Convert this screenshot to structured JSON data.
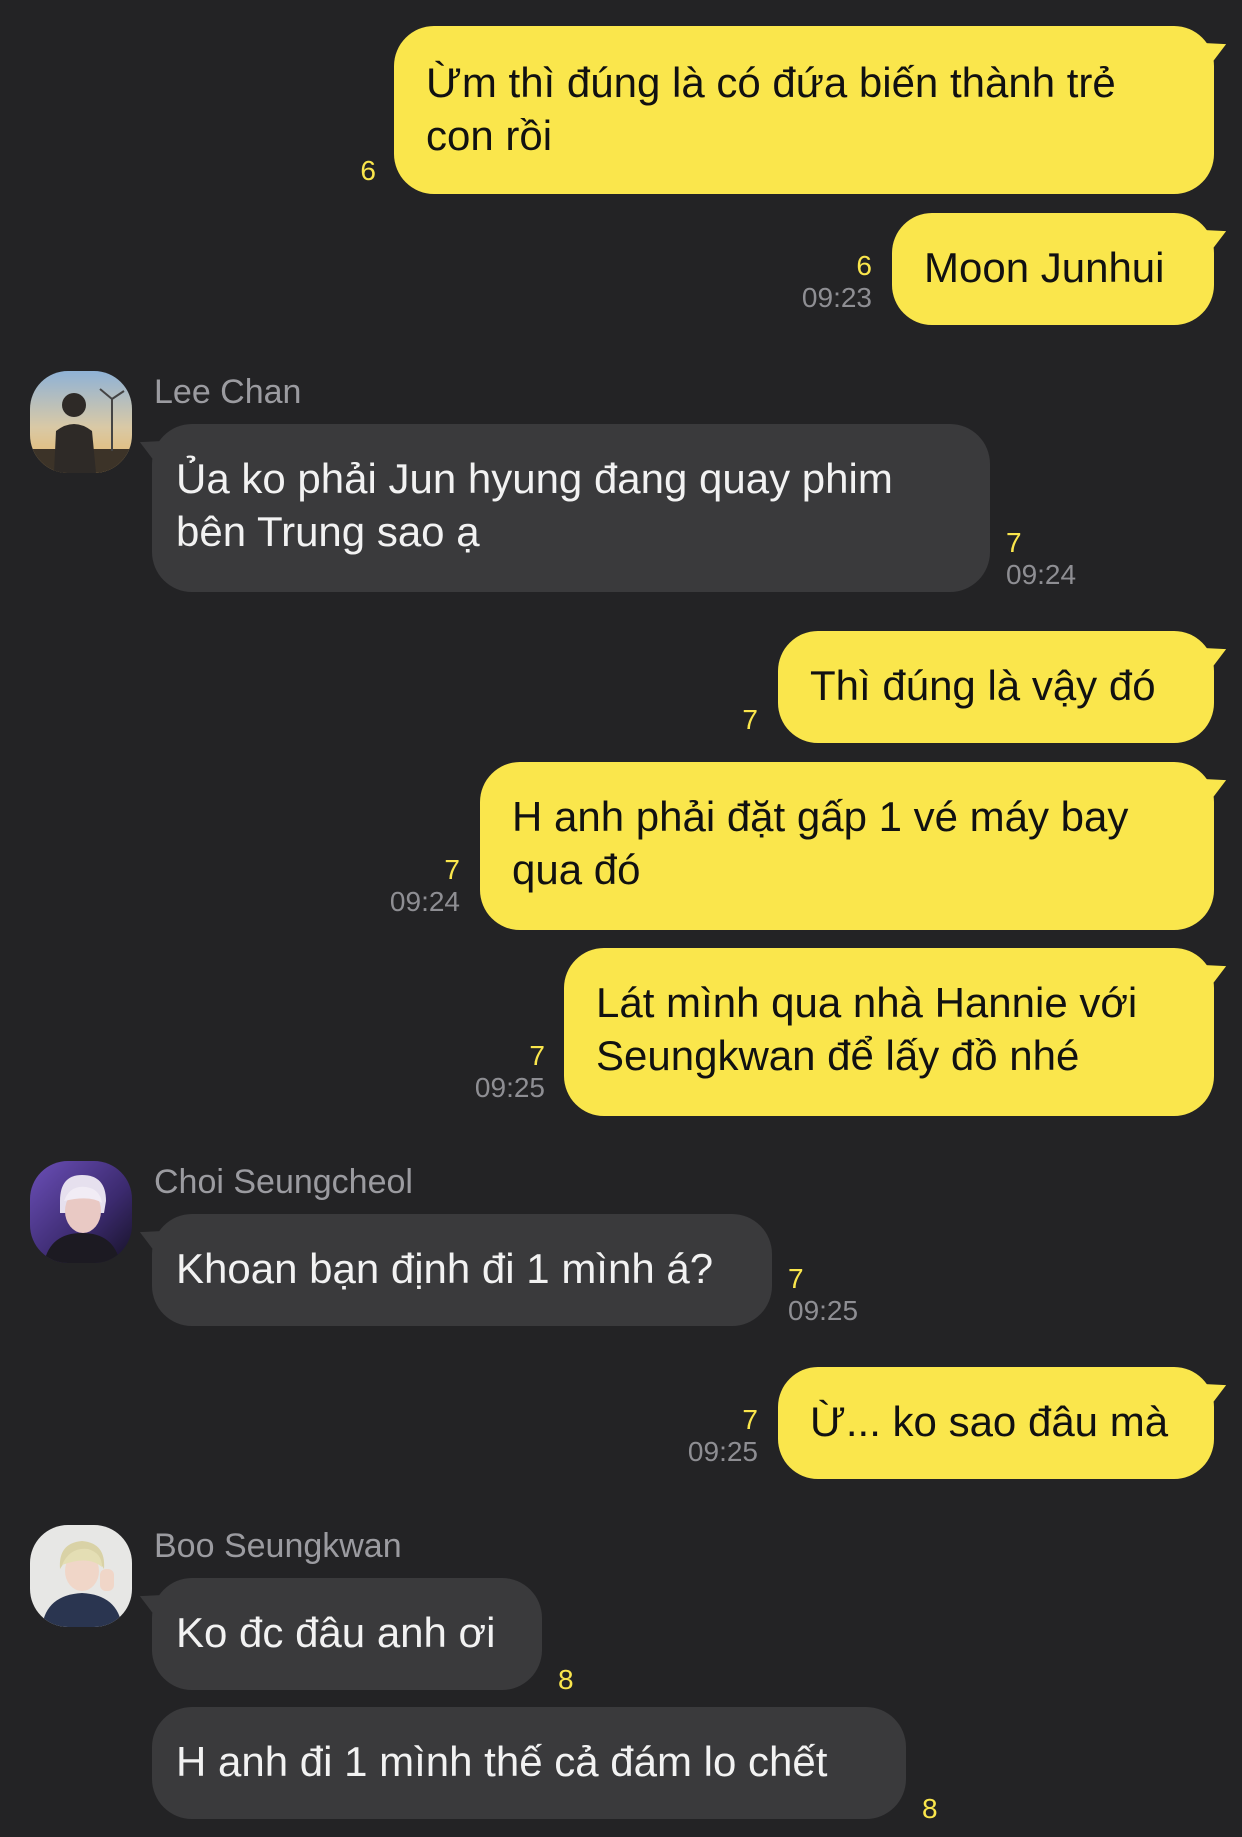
{
  "messages": [
    {
      "text": "Ừm thì đúng là có đứa biến thành trẻ con rồi",
      "count": "6",
      "time": ""
    },
    {
      "text": "Moon Junhui",
      "count": "6",
      "time": "09:23"
    },
    {
      "sender": "Lee Chan",
      "text": "Ủa ko phải Jun hyung đang quay phim bên Trung sao ạ",
      "count": "7",
      "time": "09:24"
    },
    {
      "text": "Thì đúng là vậy đó",
      "count": "7",
      "time": ""
    },
    {
      "text": "H anh phải đặt gấp 1 vé máy bay qua đó",
      "count": "7",
      "time": "09:24"
    },
    {
      "text": "Lát mình qua nhà Hannie với Seungkwan để lấy đồ nhé",
      "count": "7",
      "time": "09:25"
    },
    {
      "sender": "Choi Seungcheol",
      "text": "Khoan bạn định đi 1 mình á?",
      "count": "7",
      "time": "09:25"
    },
    {
      "text": "Ừ... ko sao đâu mà",
      "count": "7",
      "time": "09:25"
    },
    {
      "sender": "Boo Seungkwan",
      "text": "Ko đc đâu anh ơi",
      "count": "8",
      "time": ""
    },
    {
      "text": "H anh đi 1 mình thế cả đám lo chết",
      "count": "8",
      "time": ""
    }
  ],
  "colors": {
    "background": "#232325",
    "outgoing_bubble": "#FAE64C",
    "incoming_bubble": "#3A3A3C",
    "unread_count": "#FAE64C",
    "timestamp": "#8E8E93",
    "sender_name": "#9B9BA0"
  }
}
